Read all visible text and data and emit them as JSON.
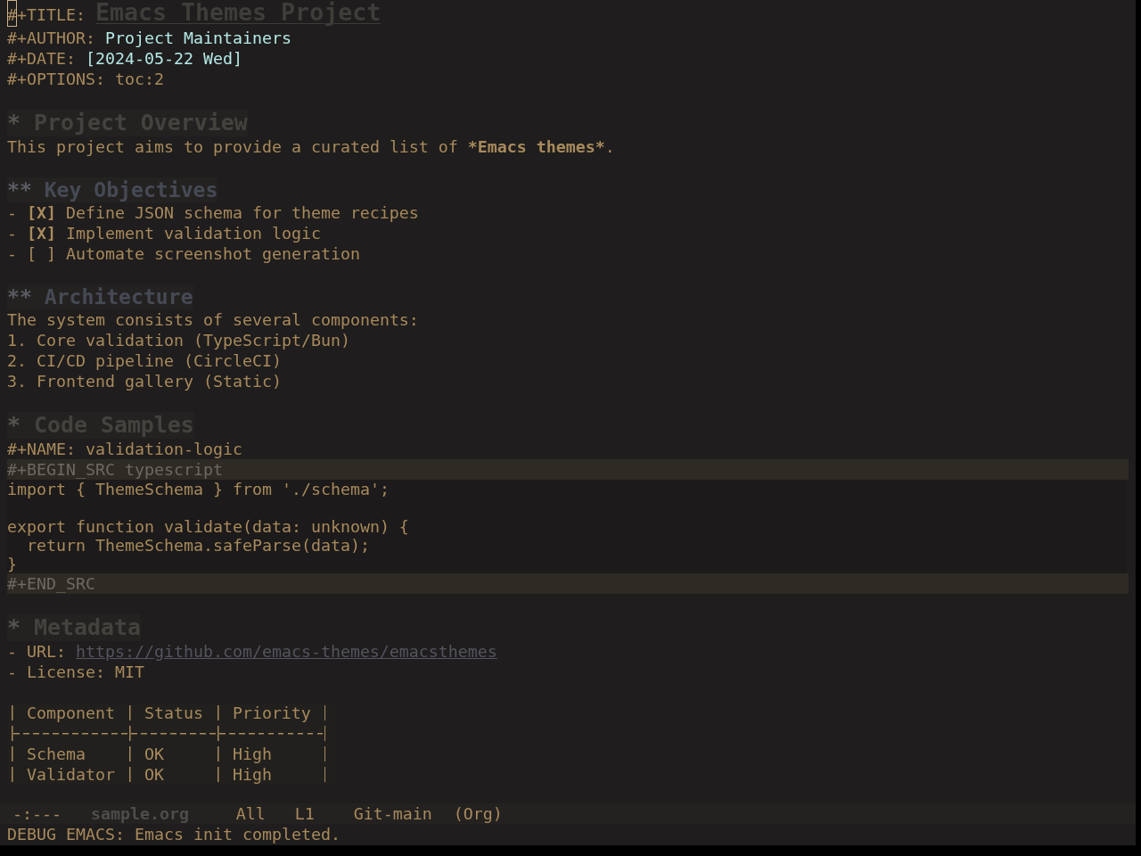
{
  "buffer": {
    "keywords": [
      {
        "kind": "title",
        "key": "#+TITLE:",
        "value": "Emacs Themes Project",
        "cursor": true
      },
      {
        "kind": "author",
        "key": "#+AUTHOR:",
        "value": "Project Maintainers",
        "cursor": false
      },
      {
        "kind": "date",
        "key": "#+DATE:",
        "value": "[2024-05-22 Wed]",
        "cursor": false
      },
      {
        "kind": "options",
        "key": "#+OPTIONS:",
        "value": "toc:2",
        "cursor": false
      }
    ],
    "outline": [
      {
        "kind": "section",
        "marker": "*",
        "title": "Project Overview",
        "body": [
          {
            "kind": "paragraph",
            "runs": [
              {
                "text": "This project aims to provide a curated list of ",
                "bold": false
              },
              {
                "text": "*Emacs themes*",
                "bold": true
              },
              {
                "text": ".",
                "bold": false
              }
            ]
          }
        ],
        "children": [
          {
            "kind": "subsection",
            "marker": "**",
            "title": "Key Objectives",
            "body": [
              {
                "kind": "checklist",
                "items": [
                  {
                    "bullet": "-",
                    "box": "[X]",
                    "checked": true,
                    "text": "Define JSON schema for theme recipes"
                  },
                  {
                    "bullet": "-",
                    "box": "[X]",
                    "checked": true,
                    "text": "Implement validation logic"
                  },
                  {
                    "bullet": "-",
                    "box": "[ ]",
                    "checked": false,
                    "text": "Automate screenshot generation"
                  }
                ]
              }
            ]
          },
          {
            "kind": "subsection",
            "marker": "**",
            "title": "Architecture",
            "body": [
              {
                "kind": "paragraph",
                "runs": [
                  {
                    "text": "The system consists of several components:",
                    "bold": false
                  }
                ]
              },
              {
                "kind": "ordered_list",
                "items": [
                  {
                    "marker": "1.",
                    "text": "Core validation (TypeScript/Bun)"
                  },
                  {
                    "marker": "2.",
                    "text": "CI/CD pipeline (CircleCI)"
                  },
                  {
                    "marker": "3.",
                    "text": "Frontend gallery (Static)"
                  }
                ]
              }
            ]
          }
        ]
      },
      {
        "kind": "section",
        "marker": "*",
        "title": "Code Samples",
        "body": [
          {
            "kind": "keyword",
            "key": "#+NAME:",
            "value": "validation-logic"
          },
          {
            "kind": "src_block",
            "begin": "#+BEGIN_SRC typescript",
            "code": "import { ThemeSchema } from './schema';\n\nexport function validate(data: unknown) {\n  return ThemeSchema.safeParse(data);\n}",
            "end": "#+END_SRC"
          }
        ]
      },
      {
        "kind": "section",
        "marker": "*",
        "title": "Metadata",
        "body": [
          {
            "kind": "list",
            "items": [
              {
                "kind": "link",
                "bullet": "-",
                "label": "URL:",
                "value": "https://github.com/emacs-themes/emacsthemes"
              },
              {
                "kind": "text",
                "bullet": "-",
                "label": "License:",
                "value": "MIT"
              }
            ]
          },
          {
            "kind": "table",
            "columns": [
              "Component",
              "Status",
              "Priority"
            ],
            "rows": [
              [
                "Schema",
                "OK",
                "High"
              ],
              [
                "Validator",
                "OK",
                "High"
              ]
            ]
          }
        ]
      }
    ]
  },
  "mode_line": {
    "status": "-:---",
    "buffer_name": "sample.org",
    "position": "All",
    "line": "L1",
    "vc": "Git-main",
    "mode": "(Org)"
  },
  "echo_area": {
    "message": "DEBUG EMACS: Emacs init completed."
  }
}
